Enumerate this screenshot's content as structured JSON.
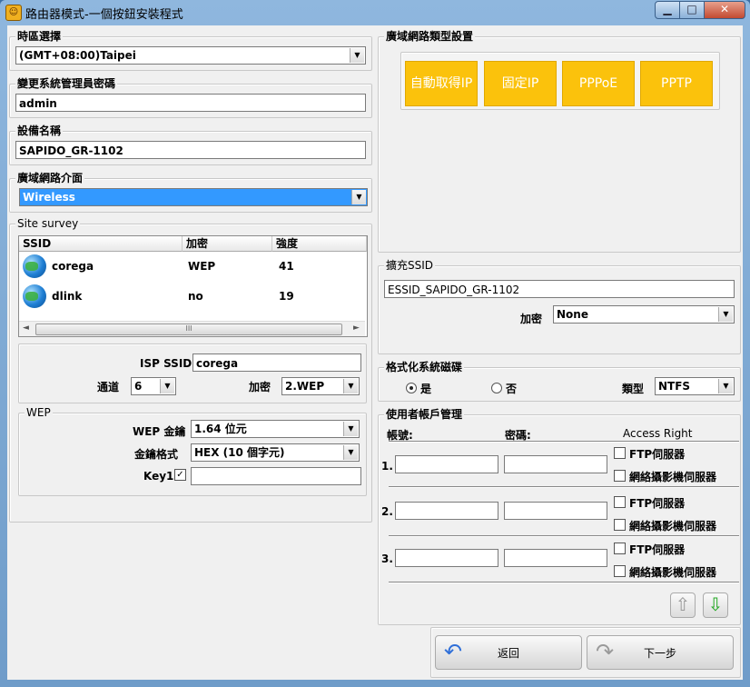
{
  "window": {
    "title": "路由器模式-一個按鈕安裝程式",
    "min": "▁",
    "max": "□",
    "close": "✕"
  },
  "timezone": {
    "label": "時區選擇",
    "value": "(GMT+08:00)Taipei"
  },
  "admin_password": {
    "label": "變更系統管理員密碼",
    "value": "admin"
  },
  "device_name": {
    "label": "設備名稱",
    "value": "SAPIDO_GR-1102"
  },
  "wan_interface": {
    "label": "廣域網路介面",
    "value": "Wireless"
  },
  "site_survey": {
    "label": "Site survey",
    "columns": [
      "SSID",
      "加密",
      "強度"
    ],
    "rows": [
      {
        "ssid": "corega",
        "enc": "WEP",
        "strength": "41"
      },
      {
        "ssid": "dlink",
        "enc": "no",
        "strength": "19"
      }
    ],
    "scroll_glyph": "III"
  },
  "isp": {
    "ssid_label": "ISP SSID",
    "ssid_value": "corega",
    "channel_label": "通道",
    "channel_value": "6",
    "enc_label": "加密",
    "enc_value": "2.WEP"
  },
  "wep": {
    "label": "WEP",
    "key_label": "WEP 金鑰",
    "key_value": "1.64 位元",
    "format_label": "金鑰格式",
    "format_value": "HEX (10 個字元)",
    "key1_label": "Key1",
    "key1_checked": "✓",
    "key1_value": ""
  },
  "wan_type": {
    "label": "廣域網路類型設置",
    "buttons": [
      "自動取得IP",
      "固定IP",
      "PPPoE",
      "PPTP"
    ]
  },
  "ext_ssid": {
    "label": "擴充SSID",
    "value": "ESSID_SAPIDO_GR-1102",
    "enc_label": "加密",
    "enc_value": "None"
  },
  "format_disk": {
    "label": "格式化系統磁碟",
    "yes": "是",
    "no": "否",
    "type_label": "類型",
    "type_value": "NTFS"
  },
  "accounts": {
    "label": "使用者帳戶管理",
    "col_account": "帳號:",
    "col_password": "密碼:",
    "col_access": "Access Right",
    "rows": [
      {
        "num": "1.",
        "ftp": "FTP伺服器",
        "cam": "網絡攝影機伺服器"
      },
      {
        "num": "2.",
        "ftp": "FTP伺服器",
        "cam": "網絡攝影機伺服器"
      },
      {
        "num": "3.",
        "ftp": "FTP伺服器",
        "cam": "網絡攝影機伺服器"
      }
    ],
    "up": "⇧",
    "down": "⇩"
  },
  "nav": {
    "back": "返回",
    "next": "下一步"
  },
  "colors": {
    "wan_button": "#fbc20c",
    "selection": "#3399ff"
  }
}
